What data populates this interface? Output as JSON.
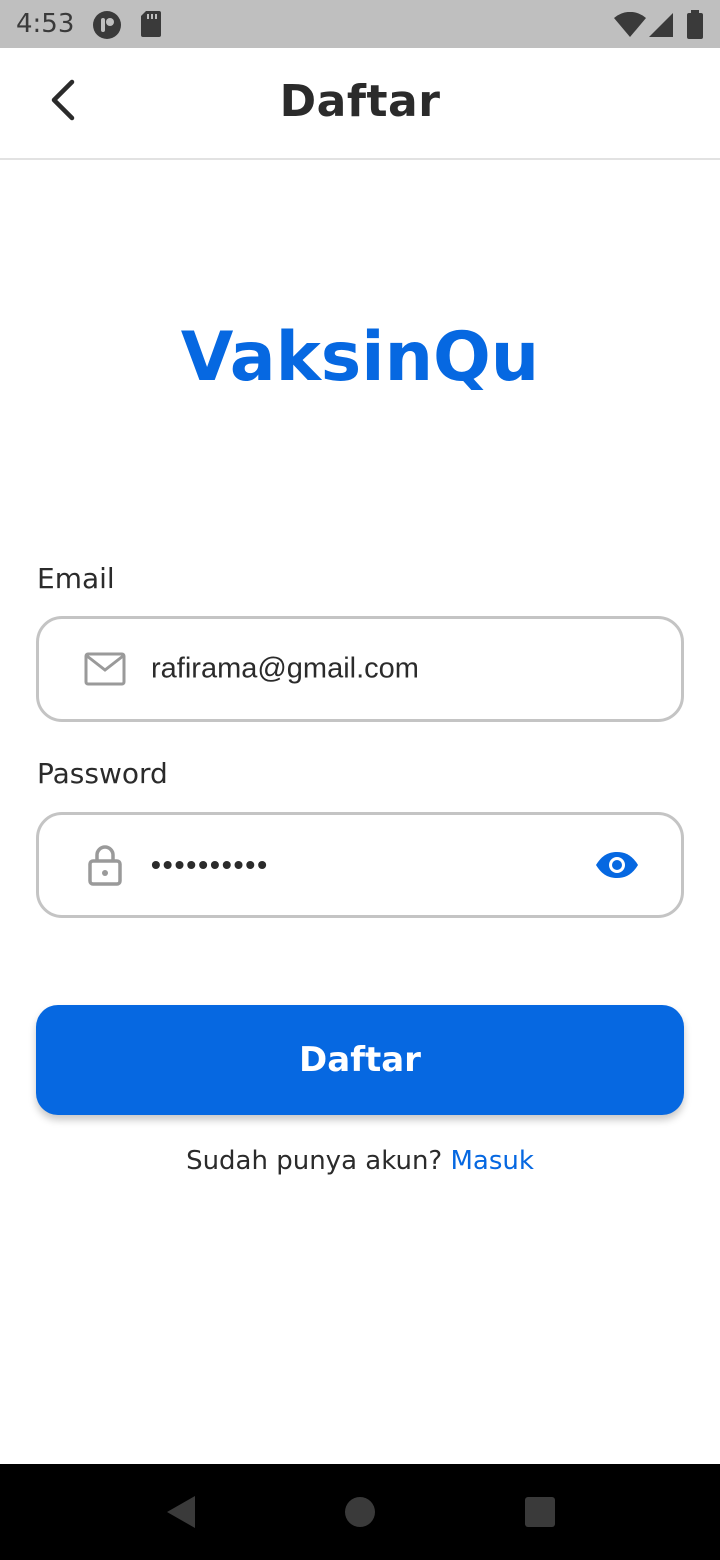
{
  "status_bar": {
    "time": "4:53",
    "icons": [
      "app-notification-icon",
      "sd-card-icon",
      "wifi-icon",
      "cell-signal-icon",
      "battery-icon"
    ]
  },
  "app_bar": {
    "title": "Daftar",
    "back_icon": "chevron-left-icon"
  },
  "brand": {
    "name": "VaksinQu",
    "color": "#0668e1"
  },
  "form": {
    "email": {
      "label": "Email",
      "value": "rafirama@gmail.com",
      "icon": "mail-icon"
    },
    "password": {
      "label": "Password",
      "value": "••••••••••",
      "icon": "lock-icon",
      "toggle_icon": "eye-icon"
    },
    "submit_label": "Daftar"
  },
  "footer": {
    "prompt": "Sudah punya akun?",
    "link": "Masuk"
  },
  "nav_bar": {
    "icons": [
      "back-triangle-icon",
      "home-circle-icon",
      "recents-square-icon"
    ]
  },
  "colors": {
    "accent": "#0668e1",
    "border": "#c4c4c4",
    "text": "#2b2b2b"
  }
}
